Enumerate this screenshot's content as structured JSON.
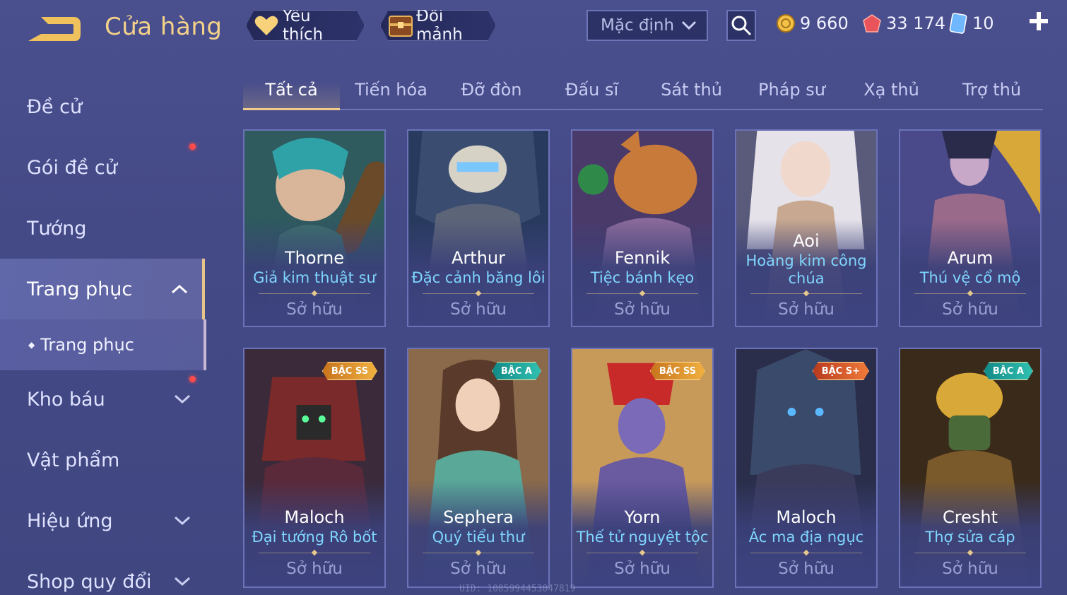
{
  "header": {
    "title": "Cửa hàng",
    "favorites_label": "Yêu thích",
    "exchange_label": "Đổi mảnh",
    "sort_selected": "Mặc định",
    "gold": "9 660",
    "gems": "33 174",
    "vouchers": "10"
  },
  "sidebar": {
    "items": [
      {
        "label": "Đề cử"
      },
      {
        "label": "Gói đề cử"
      },
      {
        "label": "Tướng"
      },
      {
        "label": "Trang phục"
      },
      {
        "label": "Kho báu"
      },
      {
        "label": "Vật phẩm"
      },
      {
        "label": "Hiệu ứng"
      },
      {
        "label": "Shop quy đổi"
      }
    ],
    "sub_item": "Trang phục"
  },
  "tabs": [
    "Tất cả",
    "Tiến hóa",
    "Đỡ đòn",
    "Đấu sĩ",
    "Sát thủ",
    "Pháp sư",
    "Xạ thủ",
    "Trợ thủ"
  ],
  "cards": [
    {
      "hero": "Thorne",
      "skin": "Giả kim thuật sư",
      "status": "Sở hữu",
      "badge": ""
    },
    {
      "hero": "Arthur",
      "skin": "Đặc cảnh băng lôi",
      "status": "Sở hữu",
      "badge": ""
    },
    {
      "hero": "Fennik",
      "skin": "Tiệc bánh kẹo",
      "status": "Sở hữu",
      "badge": ""
    },
    {
      "hero": "Aoi",
      "skin": "Hoàng kim công chúa",
      "status": "Sở hữu",
      "badge": ""
    },
    {
      "hero": "Arum",
      "skin": "Thú vệ cổ mộ",
      "status": "Sở hữu",
      "badge": ""
    },
    {
      "hero": "Maloch",
      "skin": "Đại tướng Rô bốt",
      "status": "Sở hữu",
      "badge": "BẬC SS"
    },
    {
      "hero": "Sephera",
      "skin": "Quý tiểu thư",
      "status": "Sở hữu",
      "badge": "BẬC A"
    },
    {
      "hero": "Yorn",
      "skin": "Thế tử nguyệt tộc",
      "status": "Sở hữu",
      "badge": "BẬC SS"
    },
    {
      "hero": "Maloch",
      "skin": "Ác ma địa ngục",
      "status": "Sở hữu",
      "badge": "BẬC S+"
    },
    {
      "hero": "Cresht",
      "skin": "Thợ sửa cáp",
      "status": "Sở hữu",
      "badge": "BẬC A"
    }
  ],
  "footer": {
    "uid": "UID: 1085994453047819"
  },
  "colors": {
    "accent_gold": "#f0cc8c",
    "skin_name": "#7fd6ff",
    "badge_ss": "#d98a2b",
    "badge_a": "#1fa7a0",
    "badge_splus": "#d8542e"
  }
}
